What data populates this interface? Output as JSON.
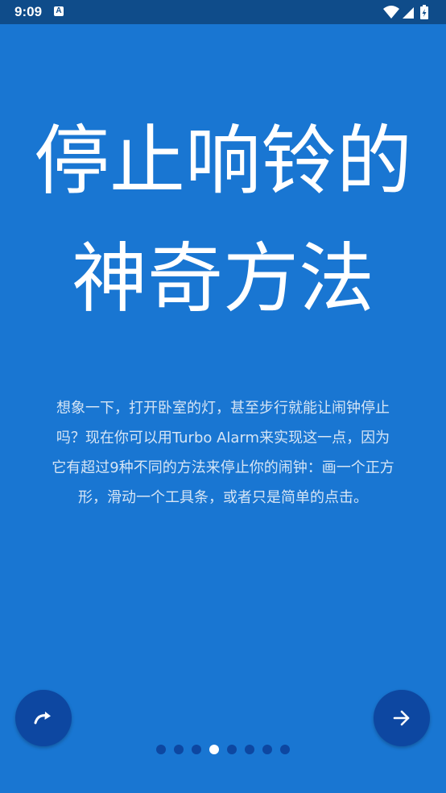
{
  "status_bar": {
    "time": "9:09",
    "notification_glyph": "A",
    "icons": [
      "wifi-icon",
      "signal-icon",
      "battery-charging-icon"
    ]
  },
  "headline": {
    "line1": "停止响铃的",
    "line2": "神奇方法"
  },
  "description": {
    "lines": [
      "想象一下，打开卧室的灯，甚至步行就能让闹钟停止",
      "吗？现在你可以用Turbo Alarm来实现这一点，因为",
      "它有超过9种不同的方法来停止你的闹钟：画一个正方",
      "形，滑动一个工具条，或者只是简单的点击。"
    ]
  },
  "buttons": {
    "skip_icon": "curved-arrow-icon",
    "next_icon": "arrow-right-icon"
  },
  "pager": {
    "total_pages": 8,
    "current_page": 4
  },
  "colors": {
    "background": "#1976D2",
    "status_bar": "#0F4C8A",
    "fab": "#0D47A1",
    "dot_inactive": "#0D47A1",
    "dot_active": "#FFFFFF"
  }
}
